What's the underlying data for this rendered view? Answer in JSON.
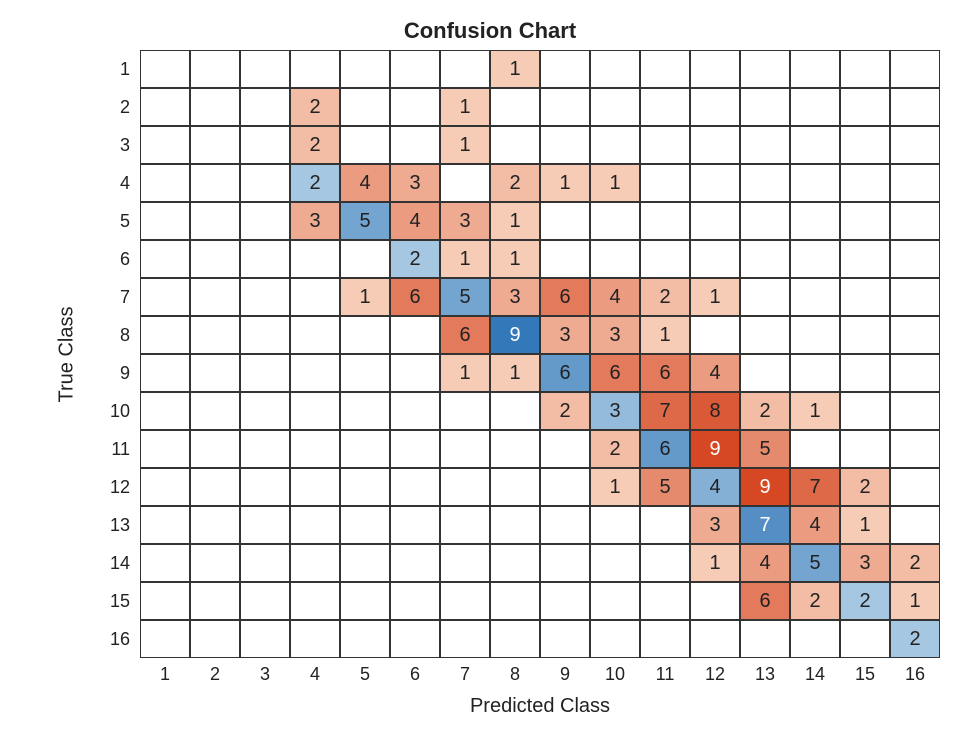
{
  "chart_data": {
    "type": "heatmap",
    "title": "Confusion Chart",
    "xlabel": "Predicted Class",
    "ylabel": "True Class",
    "x_categories": [
      "1",
      "2",
      "3",
      "4",
      "5",
      "6",
      "7",
      "8",
      "9",
      "10",
      "11",
      "12",
      "13",
      "14",
      "15",
      "16"
    ],
    "y_categories": [
      "1",
      "2",
      "3",
      "4",
      "5",
      "6",
      "7",
      "8",
      "9",
      "10",
      "11",
      "12",
      "13",
      "14",
      "15",
      "16"
    ],
    "matrix": [
      [
        0,
        0,
        0,
        0,
        0,
        0,
        0,
        1,
        0,
        0,
        0,
        0,
        0,
        0,
        0,
        0
      ],
      [
        0,
        0,
        0,
        2,
        0,
        0,
        1,
        0,
        0,
        0,
        0,
        0,
        0,
        0,
        0,
        0
      ],
      [
        0,
        0,
        0,
        2,
        0,
        0,
        1,
        0,
        0,
        0,
        0,
        0,
        0,
        0,
        0,
        0
      ],
      [
        0,
        0,
        0,
        2,
        4,
        3,
        0,
        2,
        1,
        1,
        0,
        0,
        0,
        0,
        0,
        0
      ],
      [
        0,
        0,
        0,
        3,
        5,
        4,
        3,
        1,
        0,
        0,
        0,
        0,
        0,
        0,
        0,
        0
      ],
      [
        0,
        0,
        0,
        0,
        0,
        2,
        1,
        1,
        0,
        0,
        0,
        0,
        0,
        0,
        0,
        0
      ],
      [
        0,
        0,
        0,
        0,
        1,
        6,
        5,
        3,
        6,
        4,
        2,
        1,
        0,
        0,
        0,
        0
      ],
      [
        0,
        0,
        0,
        0,
        0,
        0,
        6,
        9,
        3,
        3,
        1,
        0,
        0,
        0,
        0,
        0
      ],
      [
        0,
        0,
        0,
        0,
        0,
        0,
        1,
        1,
        6,
        6,
        6,
        4,
        0,
        0,
        0,
        0
      ],
      [
        0,
        0,
        0,
        0,
        0,
        0,
        0,
        0,
        2,
        3,
        7,
        8,
        2,
        1,
        0,
        0
      ],
      [
        0,
        0,
        0,
        0,
        0,
        0,
        0,
        0,
        0,
        2,
        6,
        9,
        5,
        0,
        0,
        0
      ],
      [
        0,
        0,
        0,
        0,
        0,
        0,
        0,
        0,
        0,
        1,
        5,
        4,
        9,
        7,
        2,
        0
      ],
      [
        0,
        0,
        0,
        0,
        0,
        0,
        0,
        0,
        0,
        0,
        0,
        3,
        7,
        4,
        1,
        0
      ],
      [
        0,
        0,
        0,
        0,
        0,
        0,
        0,
        0,
        0,
        0,
        0,
        1,
        4,
        5,
        3,
        2
      ],
      [
        0,
        0,
        0,
        0,
        0,
        0,
        0,
        0,
        0,
        0,
        0,
        0,
        6,
        2,
        2,
        1
      ],
      [
        0,
        0,
        0,
        0,
        0,
        0,
        0,
        0,
        0,
        0,
        0,
        0,
        0,
        0,
        0,
        2
      ]
    ],
    "note": "Diagonal cells colored blue (correct), off-diagonal orange (errors). Intensity scales with value; max off-diagonal value is 9."
  }
}
